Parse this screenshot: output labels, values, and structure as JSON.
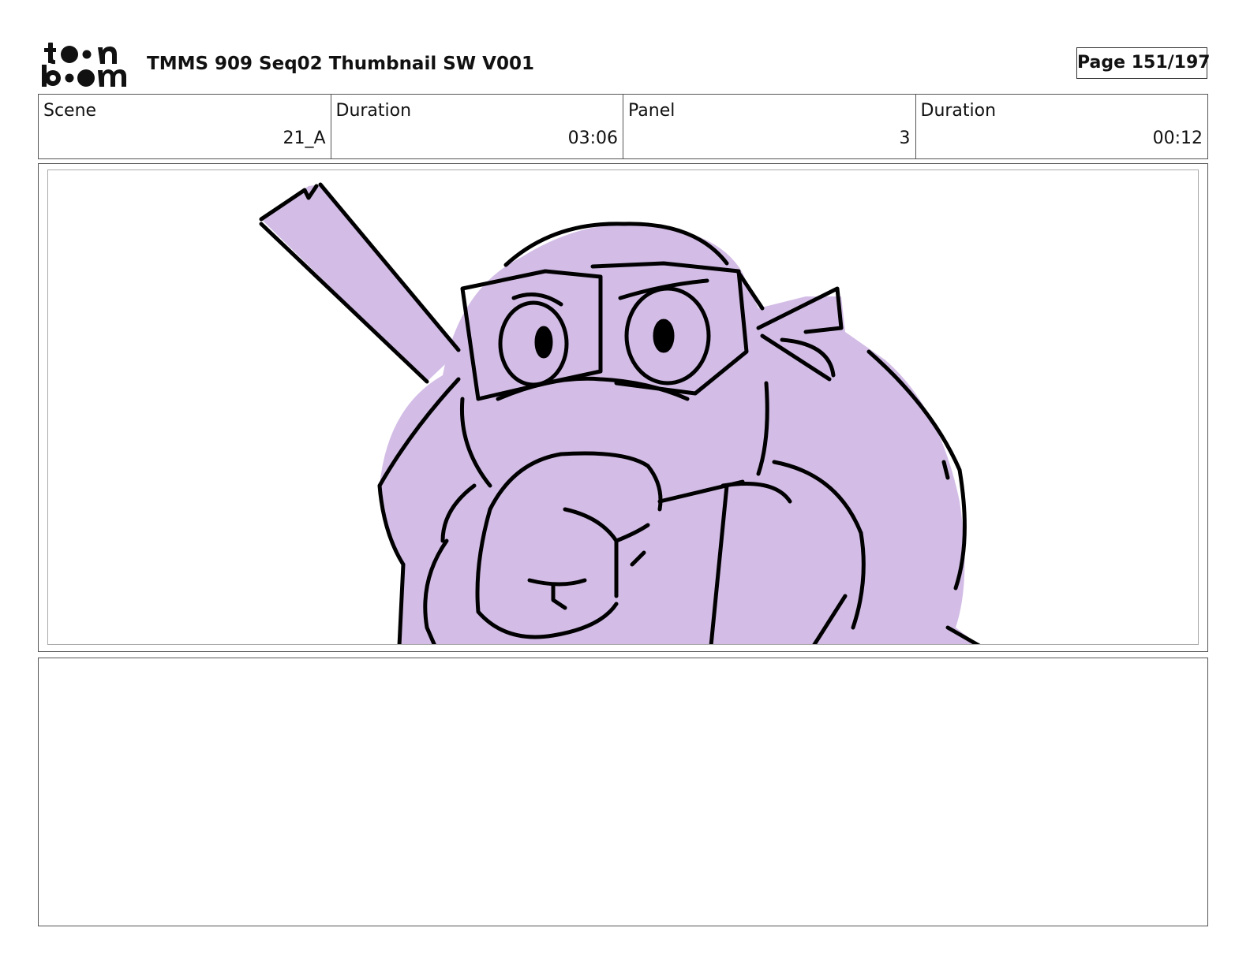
{
  "header": {
    "logo_text": "toon boom",
    "title": "TMMS 909 Seq02 Thumbnail SW V001",
    "page": "Page 151/197"
  },
  "info": [
    {
      "label": "Scene",
      "value": "21_A"
    },
    {
      "label": "Duration",
      "value": "03:06"
    },
    {
      "label": "Panel",
      "value": "3"
    },
    {
      "label": "Duration",
      "value": "00:12"
    }
  ],
  "panel": {
    "fill_color": "#d3bde6",
    "line_color": "#000000"
  }
}
